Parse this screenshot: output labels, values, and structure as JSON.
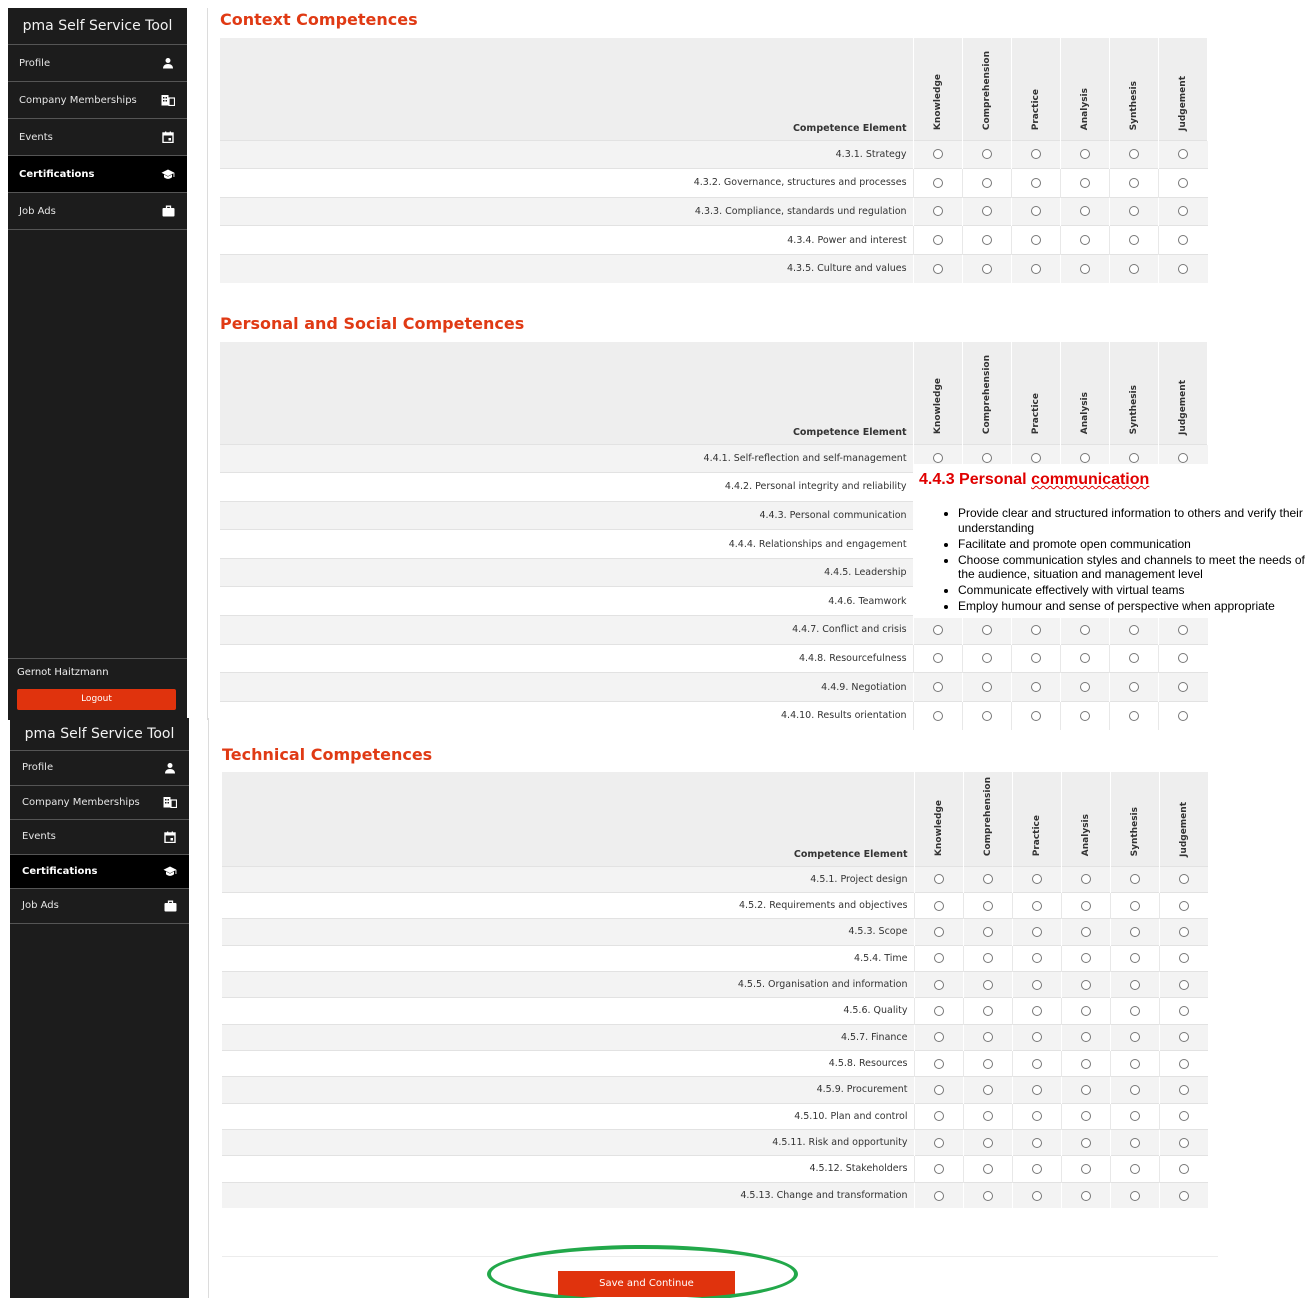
{
  "sidebar": {
    "title": "pma Self Service Tool",
    "items": [
      {
        "label": "Profile",
        "icon": "person-icon"
      },
      {
        "label": "Company Memberships",
        "icon": "building-icon"
      },
      {
        "label": "Events",
        "icon": "calendar-icon"
      },
      {
        "label": "Certifications",
        "icon": "graduation-cap-icon",
        "active": true
      },
      {
        "label": "Job Ads",
        "icon": "briefcase-icon"
      }
    ],
    "user": "Gernot Haitzmann",
    "logout": "Logout"
  },
  "levels": [
    "Knowledge",
    "Comprehension",
    "Practice",
    "Analysis",
    "Synthesis",
    "Judgement"
  ],
  "element_header": "Competence Element",
  "sections": {
    "context": {
      "title": "Context Competences",
      "rows": [
        "4.3.1. Strategy",
        "4.3.2. Governance, structures and processes",
        "4.3.3. Compliance, standards und regulation",
        "4.3.4. Power and interest",
        "4.3.5. Culture and values"
      ]
    },
    "personal": {
      "title": "Personal and Social Competences",
      "rows": [
        "4.4.1. Self-reflection and self-management",
        "4.4.2. Personal integrity and reliability",
        "4.4.3. Personal communication",
        "4.4.4. Relationships and engagement",
        "4.4.5. Leadership",
        "4.4.6. Teamwork",
        "4.4.7. Conflict and crisis",
        "4.4.8. Resourcefulness",
        "4.4.9. Negotiation",
        "4.4.10. Results orientation"
      ]
    },
    "technical": {
      "title": "Technical Competences",
      "rows": [
        "4.5.1. Project design",
        "4.5.2. Requirements and objectives",
        "4.5.3. Scope",
        "4.5.4. Time",
        "4.5.5. Organisation and information",
        "4.5.6. Quality",
        "4.5.7. Finance",
        "4.5.8. Resources",
        "4.5.9. Procurement",
        "4.5.10. Plan and control",
        "4.5.11. Risk and opportunity",
        "4.5.12. Stakeholders",
        "4.5.13. Change and transformation"
      ]
    }
  },
  "tooltip": {
    "title_prefix": "4.4.3 Personal ",
    "title_word": "communication",
    "bullets": [
      "Provide clear and structured information to others and verify their understanding",
      "Facilitate and promote open communication",
      "Choose communication styles and channels to meet the needs of the audience, situation and management level",
      "Communicate effectively with virtual teams",
      "Employ humour and sense of perspective when appropriate"
    ]
  },
  "save_button": "Save and Continue",
  "colors": {
    "accent": "#e03a14",
    "sidebar": "#1c1c1c",
    "highlight_circle": "#22a84a"
  }
}
